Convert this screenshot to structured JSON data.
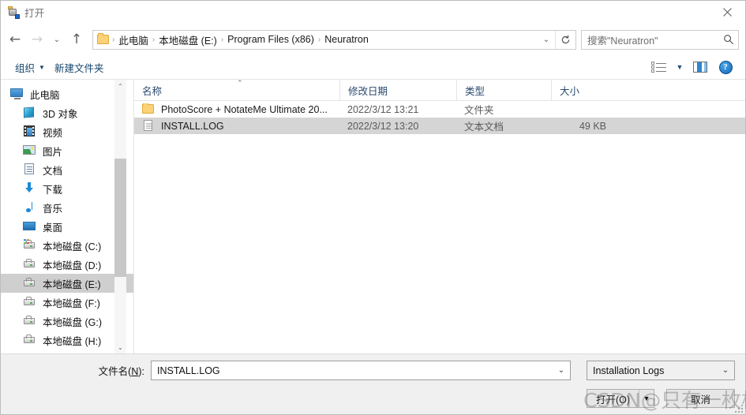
{
  "window": {
    "title": "打开",
    "title_icon": "app-icon",
    "close_label": "✕"
  },
  "nav": {
    "back_label": "←",
    "forward_label": "→",
    "recent_label": "⌄",
    "up_label": "↑",
    "refresh_label": "↻",
    "address_dropdown_label": "⌄",
    "breadcrumbs": [
      {
        "label": "此电脑"
      },
      {
        "label": "本地磁盘 (E:)"
      },
      {
        "label": "Program Files (x86)"
      },
      {
        "label": "Neuratron"
      }
    ],
    "separator": "›"
  },
  "search": {
    "placeholder": "搜索\"Neuratron\"",
    "icon": "search-icon"
  },
  "commandbar": {
    "organize_label": "组织",
    "organize_caret": "▼",
    "new_folder_label": "新建文件夹",
    "view_icon": "list-view-icon",
    "view_caret": "▼",
    "preview_pane_icon": "preview-pane-icon",
    "help_icon": "help-icon",
    "help_glyph": "?"
  },
  "sidebar": {
    "scroll_up": "⌃",
    "scroll_down": "⌄",
    "items": [
      {
        "label": "此电脑",
        "icon": "computer-icon",
        "indent": false,
        "selected": false
      },
      {
        "label": "3D 对象",
        "icon": "3d-objects-icon",
        "indent": true,
        "selected": false
      },
      {
        "label": "视频",
        "icon": "videos-icon",
        "indent": true,
        "selected": false
      },
      {
        "label": "图片",
        "icon": "pictures-icon",
        "indent": true,
        "selected": false
      },
      {
        "label": "文档",
        "icon": "documents-icon",
        "indent": true,
        "selected": false
      },
      {
        "label": "下载",
        "icon": "downloads-icon",
        "indent": true,
        "selected": false
      },
      {
        "label": "音乐",
        "icon": "music-icon",
        "indent": true,
        "selected": false
      },
      {
        "label": "桌面",
        "icon": "desktop-icon",
        "indent": true,
        "selected": false
      },
      {
        "label": "本地磁盘 (C:)",
        "icon": "system-drive-icon",
        "indent": true,
        "selected": false
      },
      {
        "label": "本地磁盘 (D:)",
        "icon": "drive-icon",
        "indent": true,
        "selected": false
      },
      {
        "label": "本地磁盘 (E:)",
        "icon": "drive-icon",
        "indent": true,
        "selected": true
      },
      {
        "label": "本地磁盘 (F:)",
        "icon": "drive-icon",
        "indent": true,
        "selected": false
      },
      {
        "label": "本地磁盘 (G:)",
        "icon": "drive-icon",
        "indent": true,
        "selected": false
      },
      {
        "label": "本地磁盘 (H:)",
        "icon": "drive-icon",
        "indent": true,
        "selected": false
      }
    ]
  },
  "filelist": {
    "columns": {
      "name": "名称",
      "date": "修改日期",
      "type": "类型",
      "size": "大小"
    },
    "sort_indicator": "⌃",
    "rows": [
      {
        "name": "PhotoScore + NotateMe Ultimate 20...",
        "date": "2022/3/12 13:21",
        "type": "文件夹",
        "size": "",
        "icon": "folder-icon",
        "selected": false
      },
      {
        "name": "INSTALL.LOG",
        "date": "2022/3/12 13:20",
        "type": "文本文档",
        "size": "49 KB",
        "icon": "text-file-icon",
        "selected": true
      }
    ]
  },
  "footer": {
    "filename_label_prefix": "文件名(",
    "filename_label_key": "N",
    "filename_label_suffix": "):",
    "filename_value": "INSTALL.LOG",
    "filename_caret": "⌄",
    "filter_value": "Installation Logs",
    "filter_caret": "⌄",
    "open_label": "打开(O)",
    "open_split_caret": "▼",
    "cancel_label": "取消"
  },
  "watermark": {
    "text": "CSDN@只有一枚梧叶"
  }
}
